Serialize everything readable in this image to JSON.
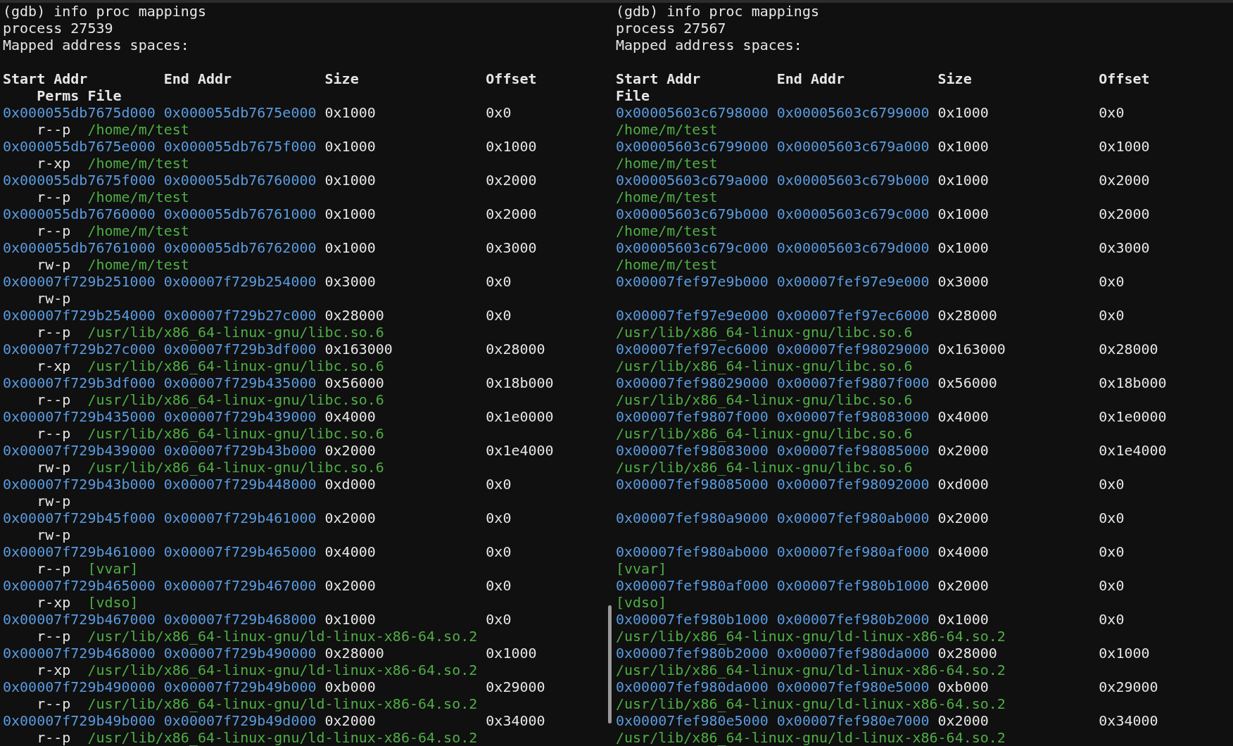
{
  "panes": [
    {
      "command": "(gdb) info proc mappings",
      "process": "process 27539",
      "title": "Mapped address spaces:",
      "columns": {
        "start": "Start Addr",
        "end": "End Addr",
        "size": "Size",
        "offset": "Offset",
        "perms": "Perms",
        "file": "File"
      },
      "rows": [
        {
          "start": "0x000055db7675d000",
          "end": "0x000055db7675e000",
          "size": "0x1000",
          "offset": "0x0",
          "perms": "r--p",
          "file": "/home/m/test"
        },
        {
          "start": "0x000055db7675e000",
          "end": "0x000055db7675f000",
          "size": "0x1000",
          "offset": "0x1000",
          "perms": "r-xp",
          "file": "/home/m/test"
        },
        {
          "start": "0x000055db7675f000",
          "end": "0x000055db76760000",
          "size": "0x1000",
          "offset": "0x2000",
          "perms": "r--p",
          "file": "/home/m/test"
        },
        {
          "start": "0x000055db76760000",
          "end": "0x000055db76761000",
          "size": "0x1000",
          "offset": "0x2000",
          "perms": "r--p",
          "file": "/home/m/test"
        },
        {
          "start": "0x000055db76761000",
          "end": "0x000055db76762000",
          "size": "0x1000",
          "offset": "0x3000",
          "perms": "rw-p",
          "file": "/home/m/test"
        },
        {
          "start": "0x00007f729b251000",
          "end": "0x00007f729b254000",
          "size": "0x3000",
          "offset": "0x0",
          "perms": "rw-p"
        },
        {
          "start": "0x00007f729b254000",
          "end": "0x00007f729b27c000",
          "size": "0x28000",
          "offset": "0x0",
          "perms": "r--p",
          "file": "/usr/lib/x86_64-linux-gnu/libc.so.6"
        },
        {
          "start": "0x00007f729b27c000",
          "end": "0x00007f729b3df000",
          "size": "0x163000",
          "offset": "0x28000",
          "perms": "r-xp",
          "file": "/usr/lib/x86_64-linux-gnu/libc.so.6"
        },
        {
          "start": "0x00007f729b3df000",
          "end": "0x00007f729b435000",
          "size": "0x56000",
          "offset": "0x18b000",
          "perms": "r--p",
          "file": "/usr/lib/x86_64-linux-gnu/libc.so.6"
        },
        {
          "start": "0x00007f729b435000",
          "end": "0x00007f729b439000",
          "size": "0x4000",
          "offset": "0x1e0000",
          "perms": "r--p",
          "file": "/usr/lib/x86_64-linux-gnu/libc.so.6"
        },
        {
          "start": "0x00007f729b439000",
          "end": "0x00007f729b43b000",
          "size": "0x2000",
          "offset": "0x1e4000",
          "perms": "rw-p",
          "file": "/usr/lib/x86_64-linux-gnu/libc.so.6"
        },
        {
          "start": "0x00007f729b43b000",
          "end": "0x00007f729b448000",
          "size": "0xd000",
          "offset": "0x0",
          "perms": "rw-p"
        },
        {
          "start": "0x00007f729b45f000",
          "end": "0x00007f729b461000",
          "size": "0x2000",
          "offset": "0x0",
          "perms": "rw-p"
        },
        {
          "start": "0x00007f729b461000",
          "end": "0x00007f729b465000",
          "size": "0x4000",
          "offset": "0x0",
          "perms": "r--p",
          "file": "[vvar]"
        },
        {
          "start": "0x00007f729b465000",
          "end": "0x00007f729b467000",
          "size": "0x2000",
          "offset": "0x0",
          "perms": "r-xp",
          "file": "[vdso]"
        },
        {
          "start": "0x00007f729b467000",
          "end": "0x00007f729b468000",
          "size": "0x1000",
          "offset": "0x0",
          "perms": "r--p",
          "file": "/usr/lib/x86_64-linux-gnu/ld-linux-x86-64.so.2"
        },
        {
          "start": "0x00007f729b468000",
          "end": "0x00007f729b490000",
          "size": "0x28000",
          "offset": "0x1000",
          "perms": "r-xp",
          "file": "/usr/lib/x86_64-linux-gnu/ld-linux-x86-64.so.2"
        },
        {
          "start": "0x00007f729b490000",
          "end": "0x00007f729b49b000",
          "size": "0xb000",
          "offset": "0x29000",
          "perms": "r--p",
          "file": "/usr/lib/x86_64-linux-gnu/ld-linux-x86-64.so.2"
        },
        {
          "start": "0x00007f729b49b000",
          "end": "0x00007f729b49d000",
          "size": "0x2000",
          "offset": "0x34000",
          "perms": "r--p",
          "file": "/usr/lib/x86_64-linux-gnu/ld-linux-x86-64.so.2"
        }
      ]
    },
    {
      "command": "(gdb) info proc mappings",
      "process": "process 27567",
      "title": "Mapped address spaces:",
      "columns": {
        "start": "Start Addr",
        "end": "End Addr",
        "size": "Size",
        "offset": "Offset",
        "file": "File"
      },
      "rows": [
        {
          "start": "0x00005603c6798000",
          "end": "0x00005603c6799000",
          "size": "0x1000",
          "offset": "0x0",
          "file": "/home/m/test"
        },
        {
          "start": "0x00005603c6799000",
          "end": "0x00005603c679a000",
          "size": "0x1000",
          "offset": "0x1000",
          "file": "/home/m/test"
        },
        {
          "start": "0x00005603c679a000",
          "end": "0x00005603c679b000",
          "size": "0x1000",
          "offset": "0x2000",
          "file": "/home/m/test"
        },
        {
          "start": "0x00005603c679b000",
          "end": "0x00005603c679c000",
          "size": "0x1000",
          "offset": "0x2000",
          "file": "/home/m/test"
        },
        {
          "start": "0x00005603c679c000",
          "end": "0x00005603c679d000",
          "size": "0x1000",
          "offset": "0x3000",
          "file": "/home/m/test"
        },
        {
          "start": "0x00007fef97e9b000",
          "end": "0x00007fef97e9e000",
          "size": "0x3000",
          "offset": "0x0"
        },
        {
          "start": "0x00007fef97e9e000",
          "end": "0x00007fef97ec6000",
          "size": "0x28000",
          "offset": "0x0",
          "file": "/usr/lib/x86_64-linux-gnu/libc.so.6"
        },
        {
          "start": "0x00007fef97ec6000",
          "end": "0x00007fef98029000",
          "size": "0x163000",
          "offset": "0x28000",
          "file": "/usr/lib/x86_64-linux-gnu/libc.so.6"
        },
        {
          "start": "0x00007fef98029000",
          "end": "0x00007fef9807f000",
          "size": "0x56000",
          "offset": "0x18b000",
          "file": "/usr/lib/x86_64-linux-gnu/libc.so.6"
        },
        {
          "start": "0x00007fef9807f000",
          "end": "0x00007fef98083000",
          "size": "0x4000",
          "offset": "0x1e0000",
          "file": "/usr/lib/x86_64-linux-gnu/libc.so.6"
        },
        {
          "start": "0x00007fef98083000",
          "end": "0x00007fef98085000",
          "size": "0x2000",
          "offset": "0x1e4000",
          "file": "/usr/lib/x86_64-linux-gnu/libc.so.6"
        },
        {
          "start": "0x00007fef98085000",
          "end": "0x00007fef98092000",
          "size": "0xd000",
          "offset": "0x0"
        },
        {
          "start": "0x00007fef980a9000",
          "end": "0x00007fef980ab000",
          "size": "0x2000",
          "offset": "0x0"
        },
        {
          "start": "0x00007fef980ab000",
          "end": "0x00007fef980af000",
          "size": "0x4000",
          "offset": "0x0",
          "file": "[vvar]"
        },
        {
          "start": "0x00007fef980af000",
          "end": "0x00007fef980b1000",
          "size": "0x2000",
          "offset": "0x0",
          "file": "[vdso]"
        },
        {
          "start": "0x00007fef980b1000",
          "end": "0x00007fef980b2000",
          "size": "0x1000",
          "offset": "0x0",
          "file": "/usr/lib/x86_64-linux-gnu/ld-linux-x86-64.so.2"
        },
        {
          "start": "0x00007fef980b2000",
          "end": "0x00007fef980da000",
          "size": "0x28000",
          "offset": "0x1000",
          "file": "/usr/lib/x86_64-linux-gnu/ld-linux-x86-64.so.2"
        },
        {
          "start": "0x00007fef980da000",
          "end": "0x00007fef980e5000",
          "size": "0xb000",
          "offset": "0x29000",
          "file": "/usr/lib/x86_64-linux-gnu/ld-linux-x86-64.so.2"
        },
        {
          "start": "0x00007fef980e5000",
          "end": "0x00007fef980e7000",
          "size": "0x2000",
          "offset": "0x34000",
          "file": "/usr/lib/x86_64-linux-gnu/ld-linux-x86-64.so.2"
        }
      ]
    }
  ]
}
